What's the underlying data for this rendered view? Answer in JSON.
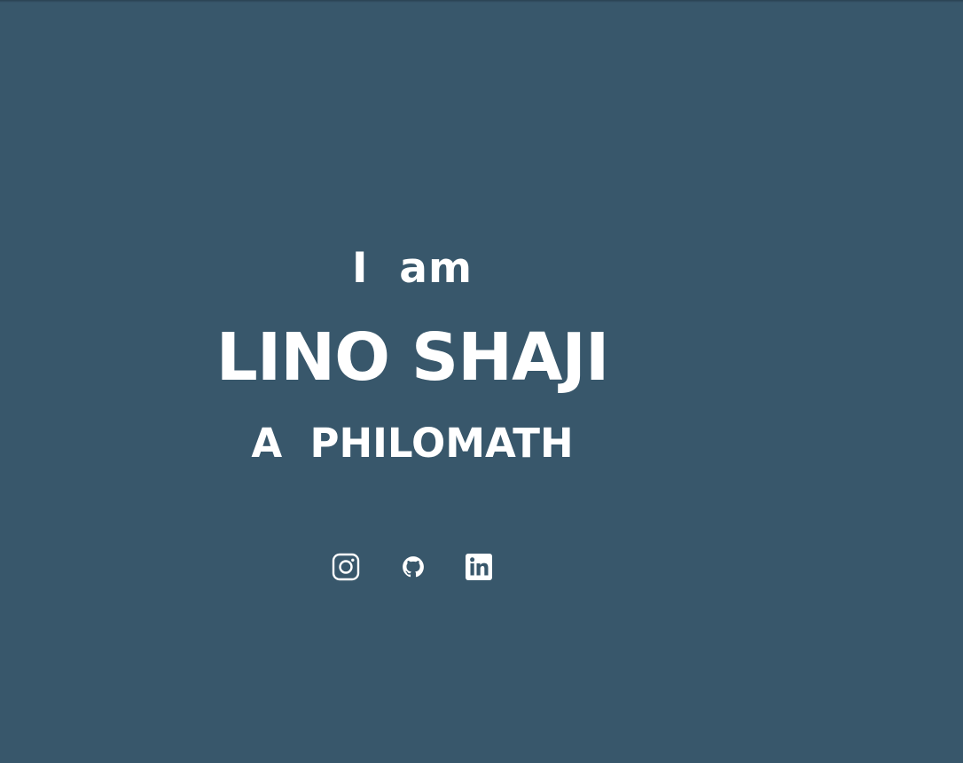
{
  "hero": {
    "intro": "I  am",
    "name": "LINO SHAJI",
    "tagline": "A  PHILOMATH"
  },
  "social": {
    "items": [
      {
        "icon": "instagram-icon"
      },
      {
        "icon": "github-icon"
      },
      {
        "icon": "linkedin-icon"
      }
    ]
  },
  "colors": {
    "background": "#38576b",
    "text": "#ffffff"
  }
}
